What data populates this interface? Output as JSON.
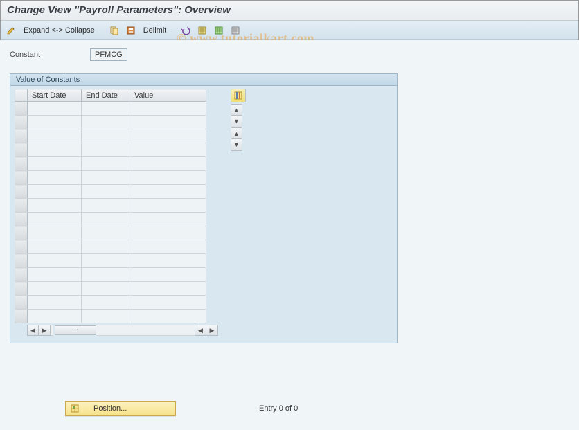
{
  "title": "Change View \"Payroll Parameters\": Overview",
  "toolbar": {
    "expand_collapse": "Expand <-> Collapse",
    "delimit": "Delimit"
  },
  "field": {
    "constant_label": "Constant",
    "constant_value": "PFMCG"
  },
  "panel": {
    "title": "Value of Constants",
    "columns": {
      "start": "Start Date",
      "end": "End Date",
      "value": "Value"
    },
    "row_count": 16
  },
  "footer": {
    "position_label": "Position...",
    "entry_text": "Entry 0 of 0"
  },
  "watermark": "© www.tutorialkart.com",
  "hscroll_thumb": ":::"
}
